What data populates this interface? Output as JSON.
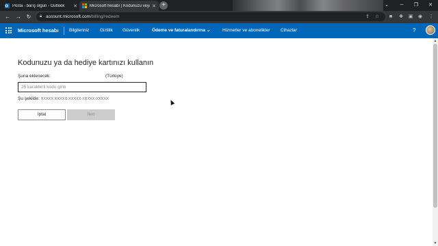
{
  "browser": {
    "tabs": [
      {
        "title": "Posta - barış olgun - Outlook",
        "active": false
      },
      {
        "title": "Microsoft hesabı | Kodunuzu veya h",
        "active": true
      }
    ],
    "new_tab_symbol": "+",
    "url_host": "account.microsoft.com",
    "url_path": "/billing/redeem",
    "colors": {
      "tabstrip": "#202124",
      "toolbar": "#35363a"
    }
  },
  "header": {
    "brand": "Microsoft hesabı",
    "nav": [
      "Bilgileriniz",
      "Gizlilik",
      "Güvenlik",
      "Ödeme ve faturalandırma",
      "Hizmetler ve abonelikler",
      "Cihazlar"
    ],
    "help_symbol": "?",
    "accent_color": "#0067b8"
  },
  "main": {
    "title": "Kodunuzu ya da hediye kartınızı kullanın",
    "add_to_label": "Şuna eklenecek:",
    "country": "(Türkiye)",
    "code_placeholder": "25 karakterli kodu girin",
    "format_label": "Şu şekilde:",
    "format_value": "XXXXX-XXXXX-XXXXX-XXXXX-XXXXX",
    "cancel_label": "İptal",
    "next_label": "İleri"
  }
}
